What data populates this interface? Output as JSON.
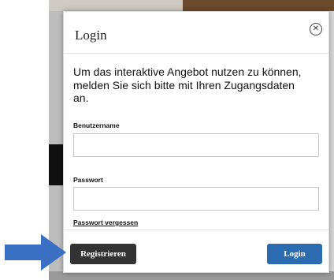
{
  "modal": {
    "title": "Login",
    "close_icon": "close-icon",
    "intro_text": "Um das interaktive Angebot nutzen zu können, melden Sie sich bitte mit Ihren Zugangsdaten an.",
    "username_label": "Benutzername",
    "username_value": "",
    "password_label": "Passwort",
    "password_value": "",
    "forgot_link": "Passwort vergessen",
    "register_button": "Registrieren",
    "login_button": "Login"
  },
  "annotation": {
    "arrow_icon": "arrow-right-icon",
    "arrow_color": "#3a6fc4"
  },
  "colors": {
    "login_button": "#2b6cb0",
    "register_button": "#333333"
  }
}
